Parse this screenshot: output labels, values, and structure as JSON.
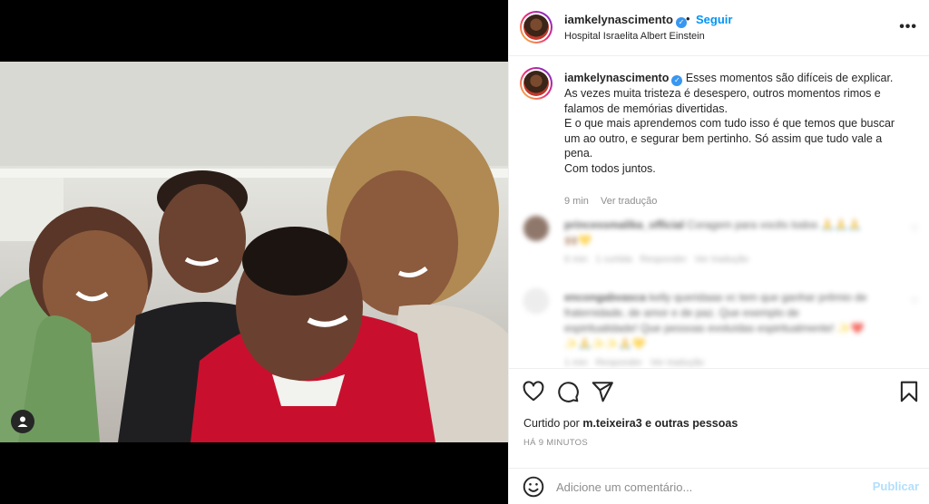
{
  "post": {
    "username": "iamkelynascimento",
    "follow_separator": "•",
    "follow_label": "Seguir",
    "location": "Hospital Israelita Albert Einstein",
    "more_label": "•••"
  },
  "caption": {
    "username": "iamkelynascimento",
    "lines": [
      "Esses momentos são difíceis de explicar.",
      "As vezes muita tristeza é desespero, outros momentos rimos e",
      "falamos de memórias divertidas.",
      "E o que mais aprendemos com tudo isso é que temos que buscar",
      "um ao outro, e segurar bem pertinho. Só assim que tudo vale a",
      "pena.",
      "Com todos juntos."
    ],
    "time": "9 min",
    "translate_label": "Ver tradução"
  },
  "comments": [
    {
      "username": "princessmalika_official",
      "text": "Coragem para vocês todos 🙏🙏🙏",
      "text2": "🙌🏽💛",
      "time": "6 min",
      "likes": "1 curtida",
      "reply": "Responder",
      "translate": "Ver tradução"
    },
    {
      "username": "encongabvasca",
      "text": "kelly queridaaa vc tem que ganhar prêmio de",
      "text2": "fraternidade, de amor e de paz. Que exemplo de",
      "text3": "espiritualidade! Que pessoas evoluídas espiritualmente! ✨❤️",
      "text4": "✨🙏✨✨🙏💛",
      "time": "1 min",
      "reply": "Responder",
      "translate": "Ver tradução"
    }
  ],
  "actions": {
    "liked_by_prefix": "Curtido por",
    "liked_by_user": "m.teixeira3",
    "liked_by_suffix": "e outras pessoas",
    "timestamp": "HÁ 9 MINUTOS"
  },
  "add_comment": {
    "placeholder": "Adicione um comentário...",
    "publish_label": "Publicar"
  },
  "colors": {
    "accent": "#0095f6",
    "publish_disabled": "#b2dffc",
    "hoodie_red": "#c8102e"
  },
  "icons": [
    "user-tag-icon",
    "verified-badge-icon",
    "more-options-icon",
    "heart-icon",
    "comment-icon",
    "share-icon",
    "bookmark-icon",
    "emoji-icon"
  ]
}
